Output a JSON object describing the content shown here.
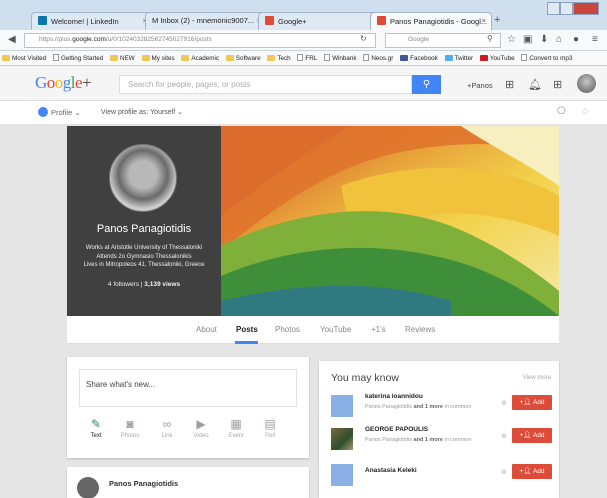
{
  "browser": {
    "tabs": [
      {
        "label": "Welcome! | LinkedIn",
        "color": "#0e76a8"
      },
      {
        "label": "M Inbox (2) - mnemonic9007...",
        "color": "#d93025"
      },
      {
        "label": "Google+",
        "color": "#dd4b39"
      },
      {
        "label": "Panos Panagiotidis - Googl...",
        "color": "#dd4b39"
      }
    ],
    "url_prefix": "https://plus.",
    "url_domain": "google.com",
    "url_rest": "/u/0/102403282562745027916/posts",
    "search_placeholder": "Google"
  },
  "bookmarks": [
    "Most Visited",
    "Getting Started",
    "NEW",
    "My sites",
    "Academic",
    "Software",
    "Tech",
    "FRL",
    "Winbank",
    "Neos.gr",
    "Facebook",
    "Twitter",
    "YouTube",
    "Convert to mp3"
  ],
  "header": {
    "logo": "Google+",
    "search_placeholder": "Search for people, pages, or posts",
    "user": "+Panos"
  },
  "profile_bar": {
    "profile_label": "Profile",
    "view_as": "View profile as: Yourself"
  },
  "profile": {
    "name": "Panos Panagiotidis",
    "info": [
      "Works at Aristotle University of Thessaloniki",
      "Attends 2o Gymnasio Thessalonikis",
      "Lives in Mitropoleos 41, Thessaloniki, Greece"
    ],
    "followers": "4 followers",
    "views": "3,139 views"
  },
  "tabs": [
    "About",
    "Posts",
    "Photos",
    "YouTube",
    "+1's",
    "Reviews"
  ],
  "share": {
    "placeholder": "Share what's new...",
    "options": [
      {
        "label": "Text",
        "icon": "pencil-icon"
      },
      {
        "label": "Photos",
        "icon": "camera-icon"
      },
      {
        "label": "Link",
        "icon": "link-icon"
      },
      {
        "label": "Video",
        "icon": "video-icon"
      },
      {
        "label": "Event",
        "icon": "calendar-icon"
      },
      {
        "label": "Poll",
        "icon": "poll-icon"
      }
    ]
  },
  "post": {
    "author": "Panos Panagiotidis"
  },
  "you_may_know": {
    "title": "You may know",
    "view_more": "View more",
    "people": [
      {
        "name": "katerina ioannidou",
        "mutual_prefix": "Panos Panagiotidis",
        "mutual_more": "and 1 more",
        "mutual_suffix": "in common",
        "add": "Add"
      },
      {
        "name": "GEORGE PAPOULIS",
        "mutual_prefix": "Panos Panagiotidis",
        "mutual_more": "and 1 more",
        "mutual_suffix": "in common",
        "add": "Add"
      },
      {
        "name": "Anastasia Keleki",
        "mutual_prefix": "",
        "mutual_more": "",
        "mutual_suffix": "",
        "add": "Add"
      }
    ]
  },
  "colors": {
    "accent": "#4285f4",
    "add_button": "#dd4b39"
  }
}
